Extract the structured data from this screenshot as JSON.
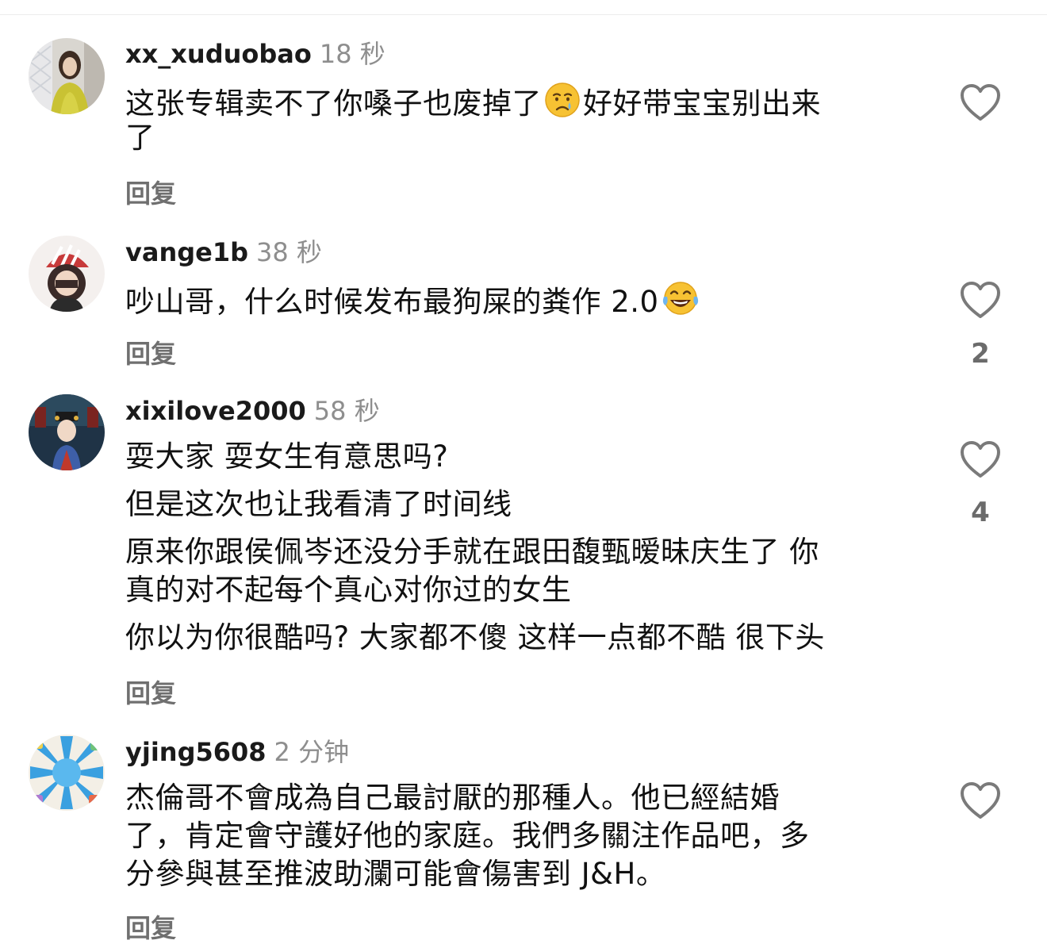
{
  "comments": [
    {
      "username": "xx_xuduobao",
      "time": "18 秒",
      "lines": [
        "这张专辑卖不了你嗓子也废掉了",
        "好好带宝宝别出来",
        "了"
      ],
      "emoji": "crying-face-emoji",
      "reply_label": "回复",
      "like_count": ""
    },
    {
      "username": "vange1b",
      "time": "38 秒",
      "lines": [
        "吵山哥，什么时候发布最狗屎的粪作 2.0"
      ],
      "emoji": "laughing-tears-emoji",
      "reply_label": "回复",
      "like_count": "2"
    },
    {
      "username": "xixilove2000",
      "time": "58 秒",
      "lines": [
        "耍大家  耍女生有意思吗?",
        "但是这次也让我看清了时间线",
        "原来你跟侯佩岑还没分手就在跟田馥甄暧昧庆生了 你",
        "真的对不起每个真心对你过的女生",
        "你以为你很酷吗? 大家都不傻 这样一点都不酷 很下头"
      ],
      "reply_label": "回复",
      "like_count": "4"
    },
    {
      "username": "yjing5608",
      "time": "2 分钟",
      "lines": [
        "杰倫哥不會成為自己最討厭的那種人。他已經結婚",
        "了，肯定會守護好他的家庭。我們多關注作品吧，多",
        "分參與甚至推波助瀾可能會傷害到 J&H。"
      ],
      "reply_label": "回复",
      "like_count": ""
    }
  ],
  "icons": {
    "like": "heart-outline-icon"
  },
  "colors": {
    "username": "#1a1a1a",
    "time": "#8e8e8e",
    "reply": "#6f6f6f",
    "text": "#111111"
  }
}
